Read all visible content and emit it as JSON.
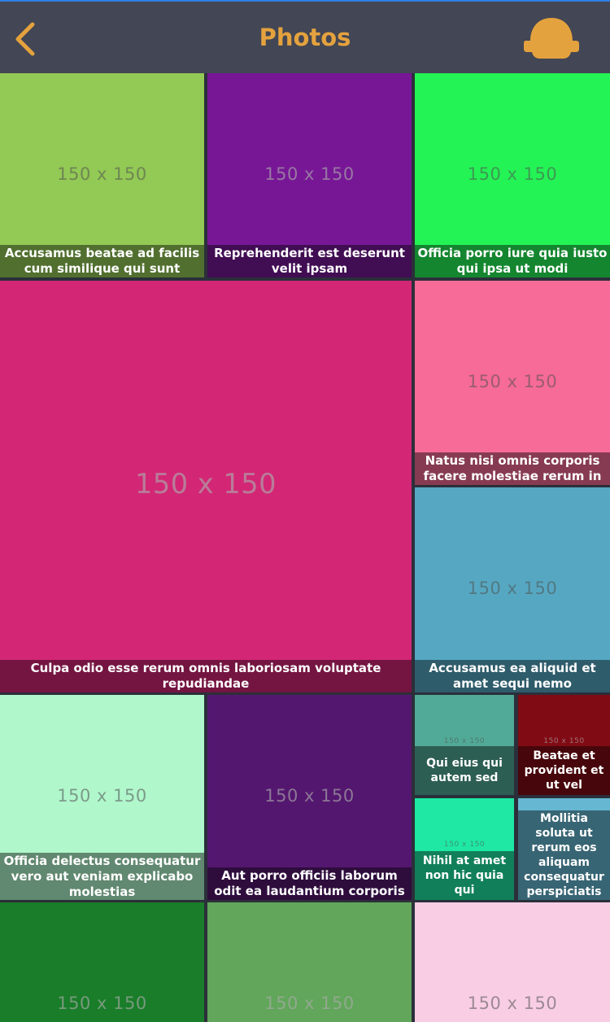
{
  "header": {
    "title": "Photos",
    "back_icon": "chevron-left-icon",
    "avatar_icon": "avatar-icon",
    "accent_color": "#e4a23e",
    "bar_color": "#434654"
  },
  "photos": [
    {
      "label": "150 x 150",
      "caption": "Accusamus beatae ad facilis cum similique qui sunt",
      "color": "#93c955"
    },
    {
      "label": "150 x 150",
      "caption": "Reprehenderit est deserunt velit ipsam",
      "color": "#771796"
    },
    {
      "label": "150 x 150",
      "caption": "Officia porro iure quia iusto qui ipsa ut modi",
      "color": "#24f355"
    },
    {
      "label": "150 x 150",
      "caption": "Culpa odio esse rerum omnis laboriosam voluptate repudiandae",
      "color": "#d32776"
    },
    {
      "label": "150 x 150",
      "caption": "Natus nisi omnis corporis facere molestiae rerum in",
      "color": "#f66b97"
    },
    {
      "label": "150 x 150",
      "caption": "Accusamus ea aliquid et amet sequi nemo",
      "color": "#56a8c2"
    },
    {
      "label": "150 x 150",
      "caption": "Officia delectus consequatur vero aut veniam explicabo molestias",
      "color": "#b0f7cc"
    },
    {
      "label": "150 x 150",
      "caption": "Aut porro officiis laborum odit ea laudantium corporis",
      "color": "#54176f"
    },
    {
      "label": "150 x 150",
      "caption": "Qui eius qui autem sed",
      "color": "#51aa97"
    },
    {
      "label": "150 x 150",
      "caption": "Beatae et provident et ut vel",
      "color": "#810b14"
    },
    {
      "label": "150 x 150",
      "caption": "Nihil at amet non hic quia qui",
      "color": "#1ee8a4"
    },
    {
      "label": "150 x 150",
      "caption": "Mollitia soluta ut rerum eos aliquam consequatur perspiciatis",
      "color": "#66b7d2"
    },
    {
      "label": "150 x 150",
      "caption": "",
      "color": "#197d29"
    },
    {
      "label": "150 x 150",
      "caption": "",
      "color": "#61a65a"
    },
    {
      "label": "150 x 150",
      "caption": "",
      "color": "#f9cee5"
    }
  ]
}
